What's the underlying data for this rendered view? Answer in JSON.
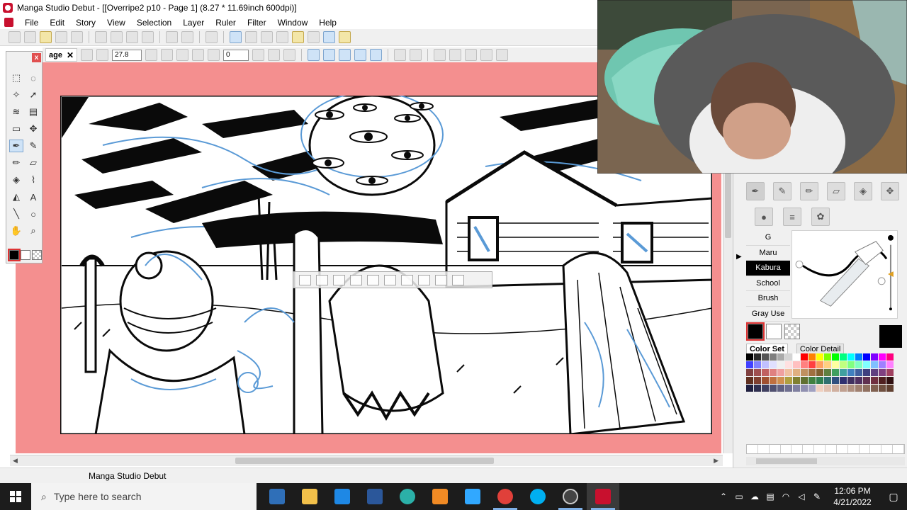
{
  "window": {
    "title": "Manga Studio Debut - [[Overripe2 p10 - Page 1] (8.27 * 11.69inch 600dpi)]"
  },
  "menu": [
    "File",
    "Edit",
    "Story",
    "View",
    "Selection",
    "Layer",
    "Ruler",
    "Filter",
    "Window",
    "Help"
  ],
  "toolbar2": {
    "tab_label": "age",
    "tab_close": "✕",
    "brush_size": "27.8",
    "rotation": "0"
  },
  "tool_palette": {
    "close": "x",
    "tools": [
      "marquee-icon",
      "lasso-icon",
      "magic-wand-icon",
      "object-select-icon",
      "layer-move-icon",
      "hand-move-icon",
      "ruler-icon",
      "move-icon",
      "pen-icon",
      "marker-icon",
      "pencil-icon",
      "eraser-icon",
      "fill-icon",
      "eyedropper-icon",
      "gradient-icon",
      "text-icon",
      "line-icon",
      "ellipse-icon",
      "hand-icon",
      "zoom-icon"
    ]
  },
  "status": {
    "text": "Manga Studio Debut"
  },
  "brush_panel": {
    "pens": [
      "G",
      "Maru",
      "Kabura",
      "School",
      "Brush",
      "Gray Use"
    ],
    "selected": "Kabura"
  },
  "color_panel": {
    "tabs": [
      "Color Set",
      "Color Detail"
    ],
    "selected_tab": "Color Set",
    "main_color": "#000000",
    "palette": [
      "#000000",
      "#2a2a2a",
      "#555555",
      "#7f7f7f",
      "#aaaaaa",
      "#d4d4d4",
      "#ffffff",
      "#ff0000",
      "#ff8000",
      "#ffff00",
      "#80ff00",
      "#00ff00",
      "#00ff80",
      "#00ffff",
      "#0080ff",
      "#0000ff",
      "#8000ff",
      "#ff00ff",
      "#ff0080",
      "#4040ff",
      "#8080ff",
      "#c0c0ff",
      "#e0e0ff",
      "#f0f0f0",
      "#ffe0e0",
      "#ffc0c0",
      "#ff8080",
      "#ff4040",
      "#ffa060",
      "#ffd080",
      "#ffffa0",
      "#c0ff80",
      "#80ff80",
      "#80ffc0",
      "#80ffff",
      "#80c0ff",
      "#a080ff",
      "#ff80ff",
      "#804040",
      "#a05050",
      "#c06060",
      "#e08080",
      "#f0a0a0",
      "#f0c0a0",
      "#e0b080",
      "#c09060",
      "#a07040",
      "#806030",
      "#608040",
      "#40a060",
      "#40a0a0",
      "#4080c0",
      "#4060a0",
      "#404080",
      "#604080",
      "#804080",
      "#a04060",
      "#603020",
      "#804030",
      "#a05030",
      "#c07040",
      "#d09050",
      "#b0a040",
      "#808030",
      "#607030",
      "#408040",
      "#308050",
      "#307070",
      "#305080",
      "#303070",
      "#403060",
      "#503060",
      "#603050",
      "#703040",
      "#502020",
      "#301010",
      "#202040",
      "#303050",
      "#404060",
      "#505070",
      "#606080",
      "#707090",
      "#8080a0",
      "#9090b0",
      "#a0a0c0",
      "#f0d0c0",
      "#e0c0b0",
      "#d0b0a0",
      "#c0a090",
      "#b09080",
      "#a08070",
      "#907060",
      "#806050",
      "#705040",
      "#604030"
    ]
  },
  "taskbar": {
    "search_placeholder": "Type here to search",
    "time": "12:06 PM",
    "date": "4/21/2022",
    "apps": [
      "task-view",
      "file-explorer",
      "mail",
      "word",
      "edge",
      "vlc",
      "photoshop",
      "chrome",
      "skype",
      "obs",
      "manga-studio"
    ]
  }
}
